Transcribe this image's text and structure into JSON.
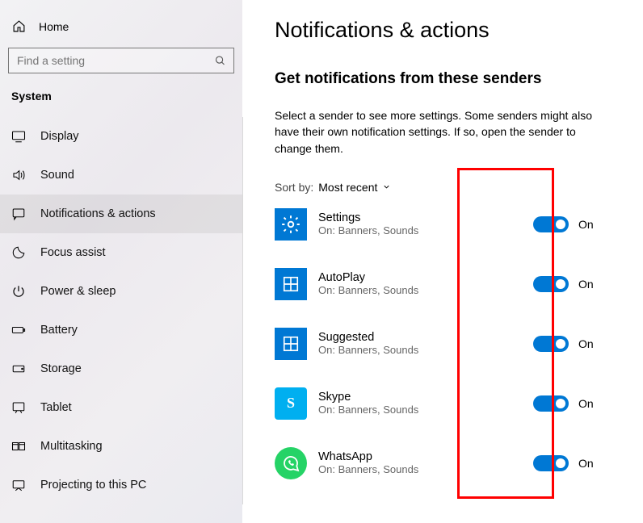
{
  "sidebar": {
    "home_label": "Home",
    "search_placeholder": "Find a setting",
    "section_title": "System",
    "items": [
      {
        "label": "Display"
      },
      {
        "label": "Sound"
      },
      {
        "label": "Notifications & actions"
      },
      {
        "label": "Focus assist"
      },
      {
        "label": "Power & sleep"
      },
      {
        "label": "Battery"
      },
      {
        "label": "Storage"
      },
      {
        "label": "Tablet"
      },
      {
        "label": "Multitasking"
      },
      {
        "label": "Projecting to this PC"
      }
    ]
  },
  "main": {
    "title": "Notifications & actions",
    "subheading": "Get notifications from these senders",
    "description": "Select a sender to see more settings. Some senders might also have their own notification settings. If so, open the sender to change them.",
    "sort_label": "Sort by:",
    "sort_value": "Most recent",
    "senders": [
      {
        "name": "Settings",
        "sub": "On: Banners, Sounds",
        "state": "On"
      },
      {
        "name": "AutoPlay",
        "sub": "On: Banners, Sounds",
        "state": "On"
      },
      {
        "name": "Suggested",
        "sub": "On: Banners, Sounds",
        "state": "On"
      },
      {
        "name": "Skype",
        "sub": "On: Banners, Sounds",
        "state": "On"
      },
      {
        "name": "WhatsApp",
        "sub": "On: Banners, Sounds",
        "state": "On"
      }
    ]
  }
}
